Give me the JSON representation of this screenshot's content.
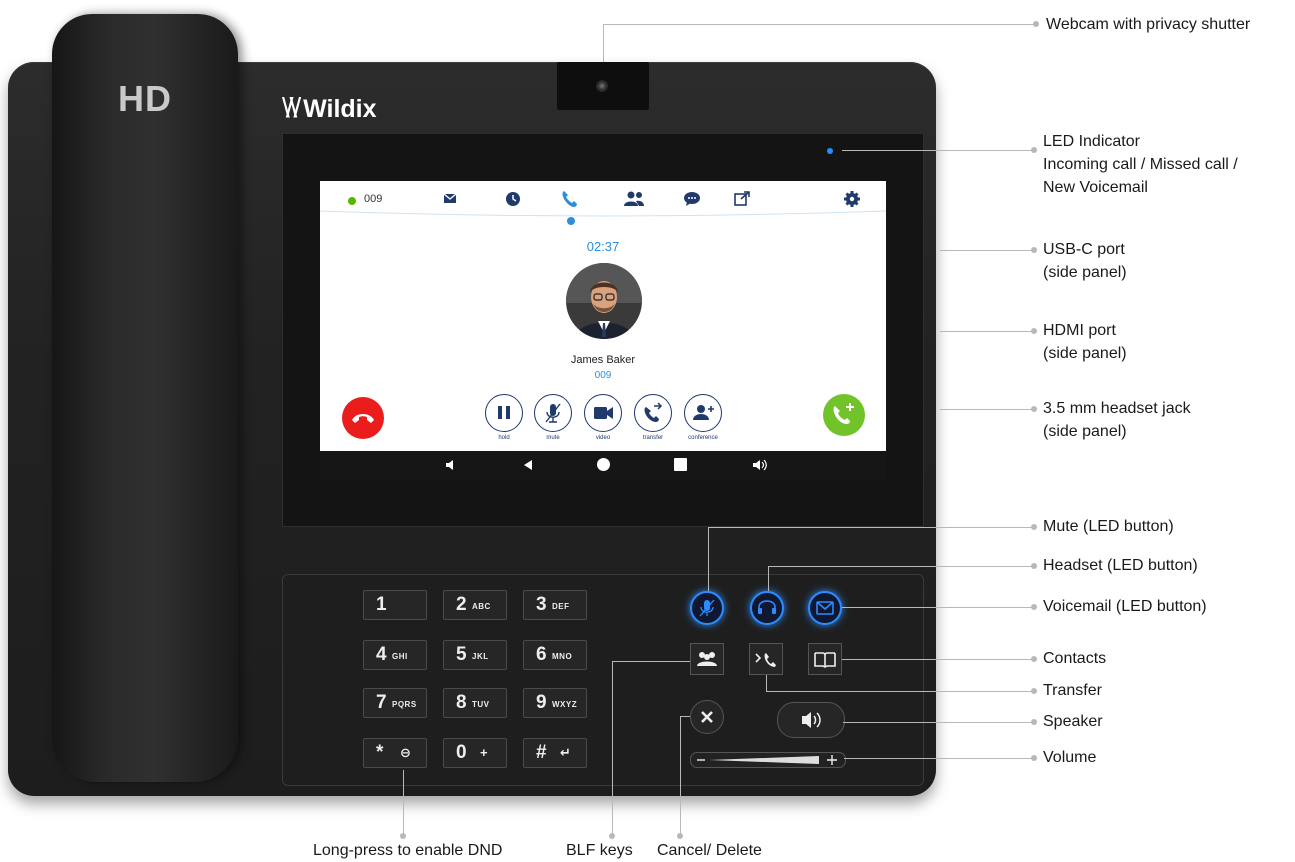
{
  "phone": {
    "hd_label": "HD",
    "brand": "Wildix"
  },
  "screen": {
    "extension": "009",
    "timer": "02:37",
    "caller_name": "James Baker",
    "caller_ext": "009",
    "top_icons": [
      "envelope-icon",
      "clock-icon",
      "phone-icon",
      "users-icon",
      "chat-icon",
      "external-link-icon",
      "gear-icon"
    ],
    "call_buttons": [
      {
        "id": "hold",
        "label": "hold"
      },
      {
        "id": "mute",
        "label": "mute"
      },
      {
        "id": "video",
        "label": "video"
      },
      {
        "id": "transfer",
        "label": "transfer"
      },
      {
        "id": "conference",
        "label": "conference"
      }
    ],
    "colors": {
      "accent": "#2e8fd8",
      "hangup": "#ea1c1c",
      "add_call": "#72c32a",
      "status": "#55b800",
      "icon": "#1f3a6b"
    }
  },
  "keypad": [
    {
      "digit": "1",
      "sub": ""
    },
    {
      "digit": "2",
      "sub": "ABC"
    },
    {
      "digit": "3",
      "sub": "DEF"
    },
    {
      "digit": "4",
      "sub": "GHI"
    },
    {
      "digit": "5",
      "sub": "JKL"
    },
    {
      "digit": "6",
      "sub": "MNO"
    },
    {
      "digit": "7",
      "sub": "PQRS"
    },
    {
      "digit": "8",
      "sub": "TUV"
    },
    {
      "digit": "9",
      "sub": "WXYZ"
    },
    {
      "digit": "*",
      "sub": "⊖"
    },
    {
      "digit": "0",
      "sub": "+"
    },
    {
      "digit": "#",
      "sub": "↵"
    }
  ],
  "callouts": {
    "webcam": "Webcam with privacy shutter",
    "led_1": "LED Indicator",
    "led_2": "Incoming call / Missed call /",
    "led_3": "New Voicemail",
    "usbc_1": "USB-C port",
    "usbc_2": "(side panel)",
    "hdmi_1": "HDMI port",
    "hdmi_2": "(side panel)",
    "jack_1": "3.5 mm headset jack",
    "jack_2": "(side panel)",
    "mute": "Mute (LED button)",
    "headset": "Headset (LED button)",
    "voicemail": "Voicemail (LED button)",
    "contacts": "Contacts",
    "transfer": "Transfer",
    "speaker": "Speaker",
    "volume": "Volume",
    "dnd": "Long-press to enable DND",
    "blf": "BLF keys",
    "cancel": "Cancel/ Delete"
  }
}
